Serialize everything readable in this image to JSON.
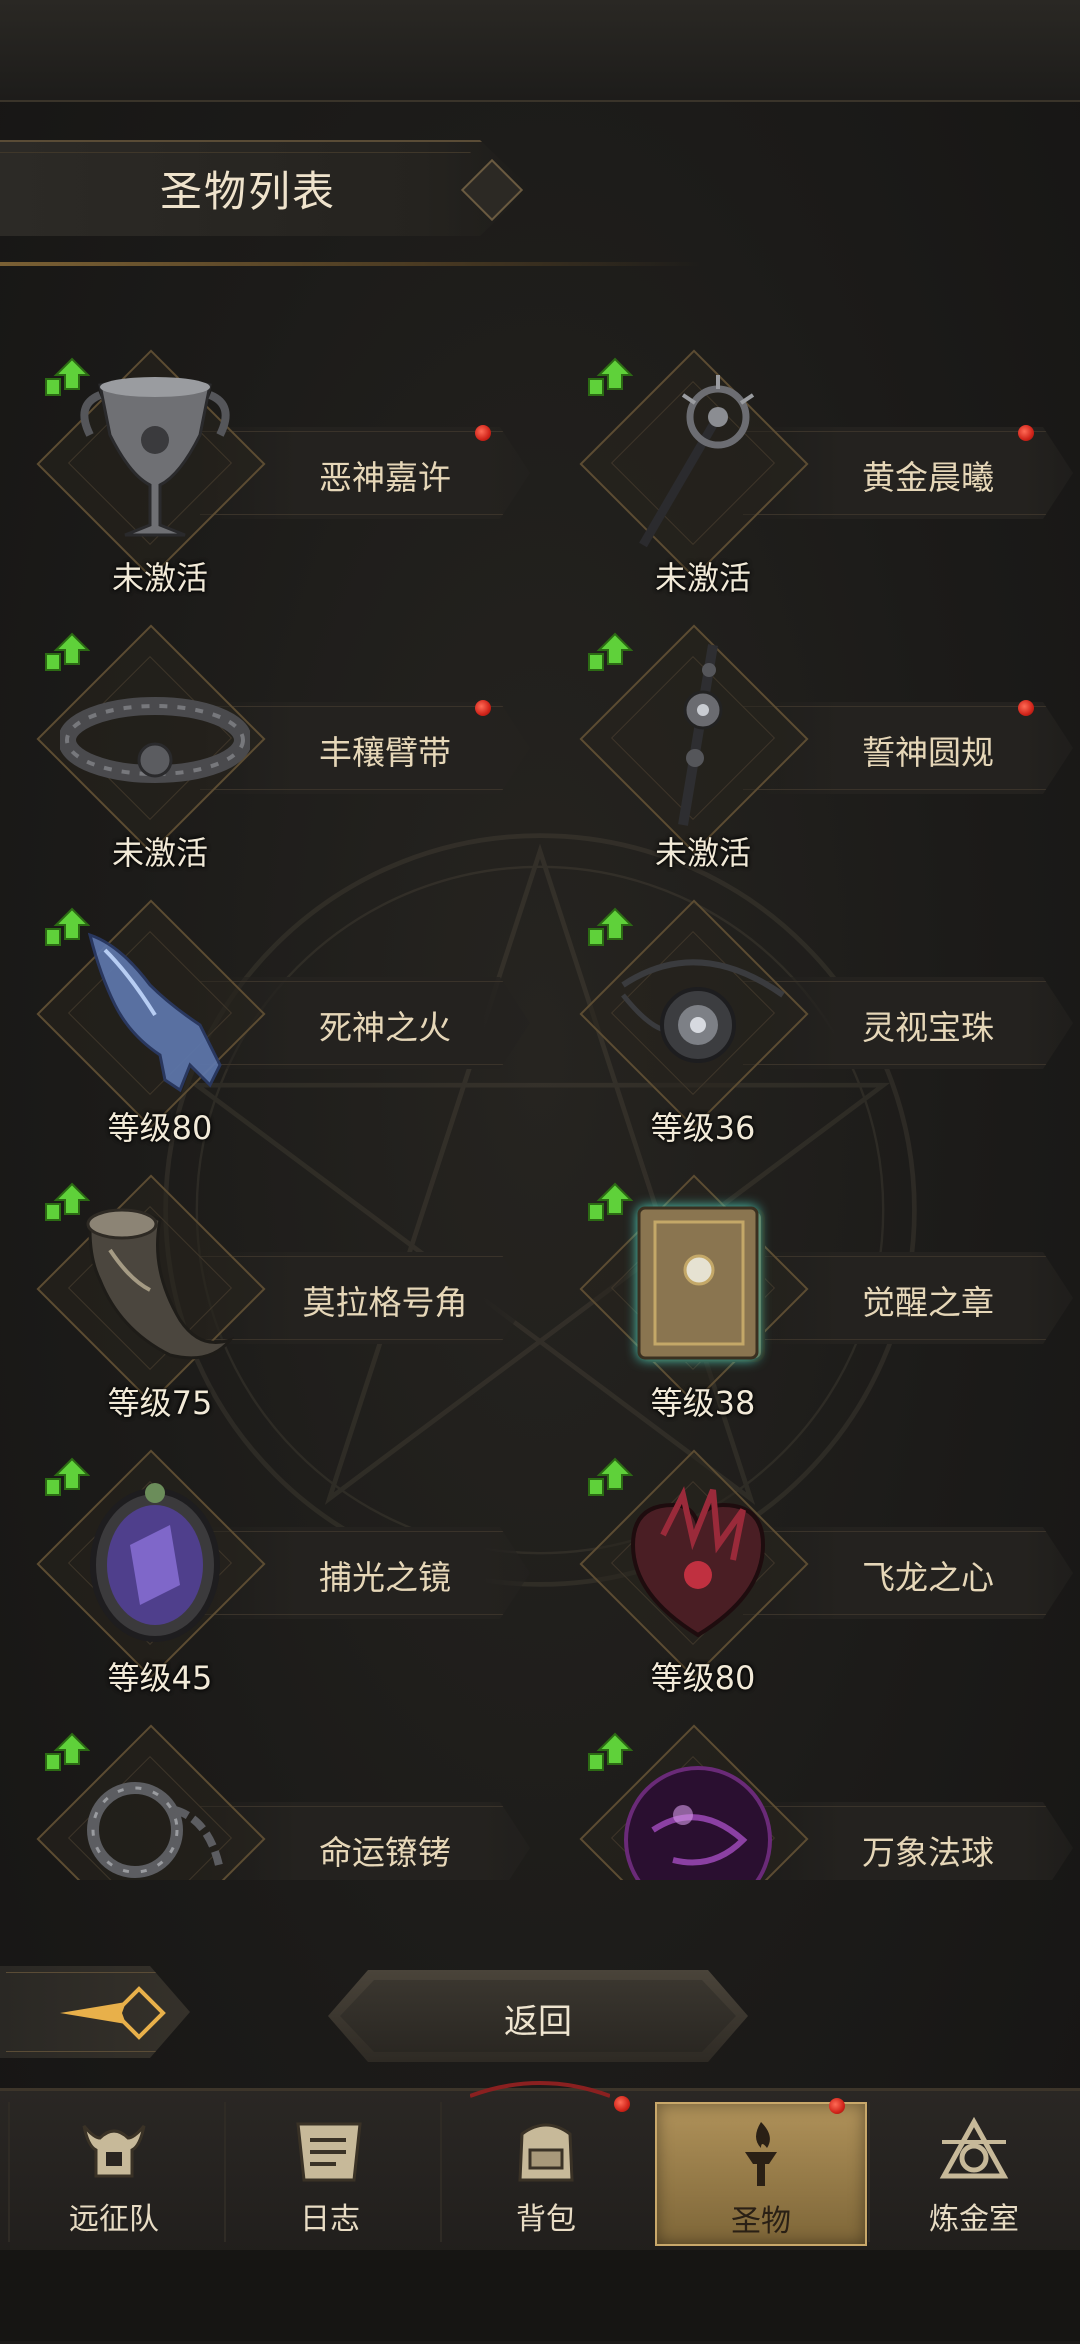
{
  "header": {
    "title": "圣物列表"
  },
  "relics": [
    {
      "name": "恶神嘉许",
      "status": "未激活",
      "has_red_dot": true,
      "icon": "chalice-icon",
      "upgradable": true
    },
    {
      "name": "黄金晨曦",
      "status": "未激活",
      "has_red_dot": true,
      "icon": "staff-icon",
      "upgradable": true
    },
    {
      "name": "丰穰臂带",
      "status": "未激活",
      "has_red_dot": true,
      "icon": "armband-icon",
      "upgradable": true
    },
    {
      "name": "誓神圆规",
      "status": "未激活",
      "has_red_dot": true,
      "icon": "compass-icon",
      "upgradable": true
    },
    {
      "name": "死神之火",
      "status": "等级80",
      "has_red_dot": false,
      "icon": "spectral-hand-icon",
      "upgradable": true
    },
    {
      "name": "灵视宝珠",
      "status": "等级36",
      "has_red_dot": false,
      "icon": "orb-amulet-icon",
      "upgradable": true
    },
    {
      "name": "莫拉格号角",
      "status": "等级75",
      "has_red_dot": false,
      "icon": "horn-icon",
      "upgradable": true
    },
    {
      "name": "觉醒之章",
      "status": "等级38",
      "has_red_dot": false,
      "icon": "tome-icon",
      "upgradable": true
    },
    {
      "name": "捕光之镜",
      "status": "等级45",
      "has_red_dot": false,
      "icon": "mirror-icon",
      "upgradable": true
    },
    {
      "name": "飞龙之心",
      "status": "等级80",
      "has_red_dot": false,
      "icon": "dragon-heart-icon",
      "upgradable": true
    },
    {
      "name": "命运镣铐",
      "status": "",
      "has_red_dot": false,
      "icon": "shackle-icon",
      "upgradable": true
    },
    {
      "name": "万象法球",
      "status": "",
      "has_red_dot": false,
      "icon": "purple-orb-icon",
      "upgradable": true
    }
  ],
  "footer": {
    "return_label": "返回"
  },
  "nav": {
    "tabs": [
      {
        "label": "远征队",
        "icon": "helmet-icon",
        "active": false,
        "has_red_dot": false
      },
      {
        "label": "日志",
        "icon": "scroll-icon",
        "active": false,
        "has_red_dot": false
      },
      {
        "label": "背包",
        "icon": "backpack-icon",
        "active": false,
        "has_red_dot": true
      },
      {
        "label": "圣物",
        "icon": "torch-icon",
        "active": true,
        "has_red_dot": true
      },
      {
        "label": "炼金室",
        "icon": "alchemy-icon",
        "active": false,
        "has_red_dot": false
      }
    ]
  },
  "colors": {
    "accent_gold": "#c9a86a",
    "red_dot": "#d0241a",
    "upgrade_green": "#5fd13a"
  }
}
